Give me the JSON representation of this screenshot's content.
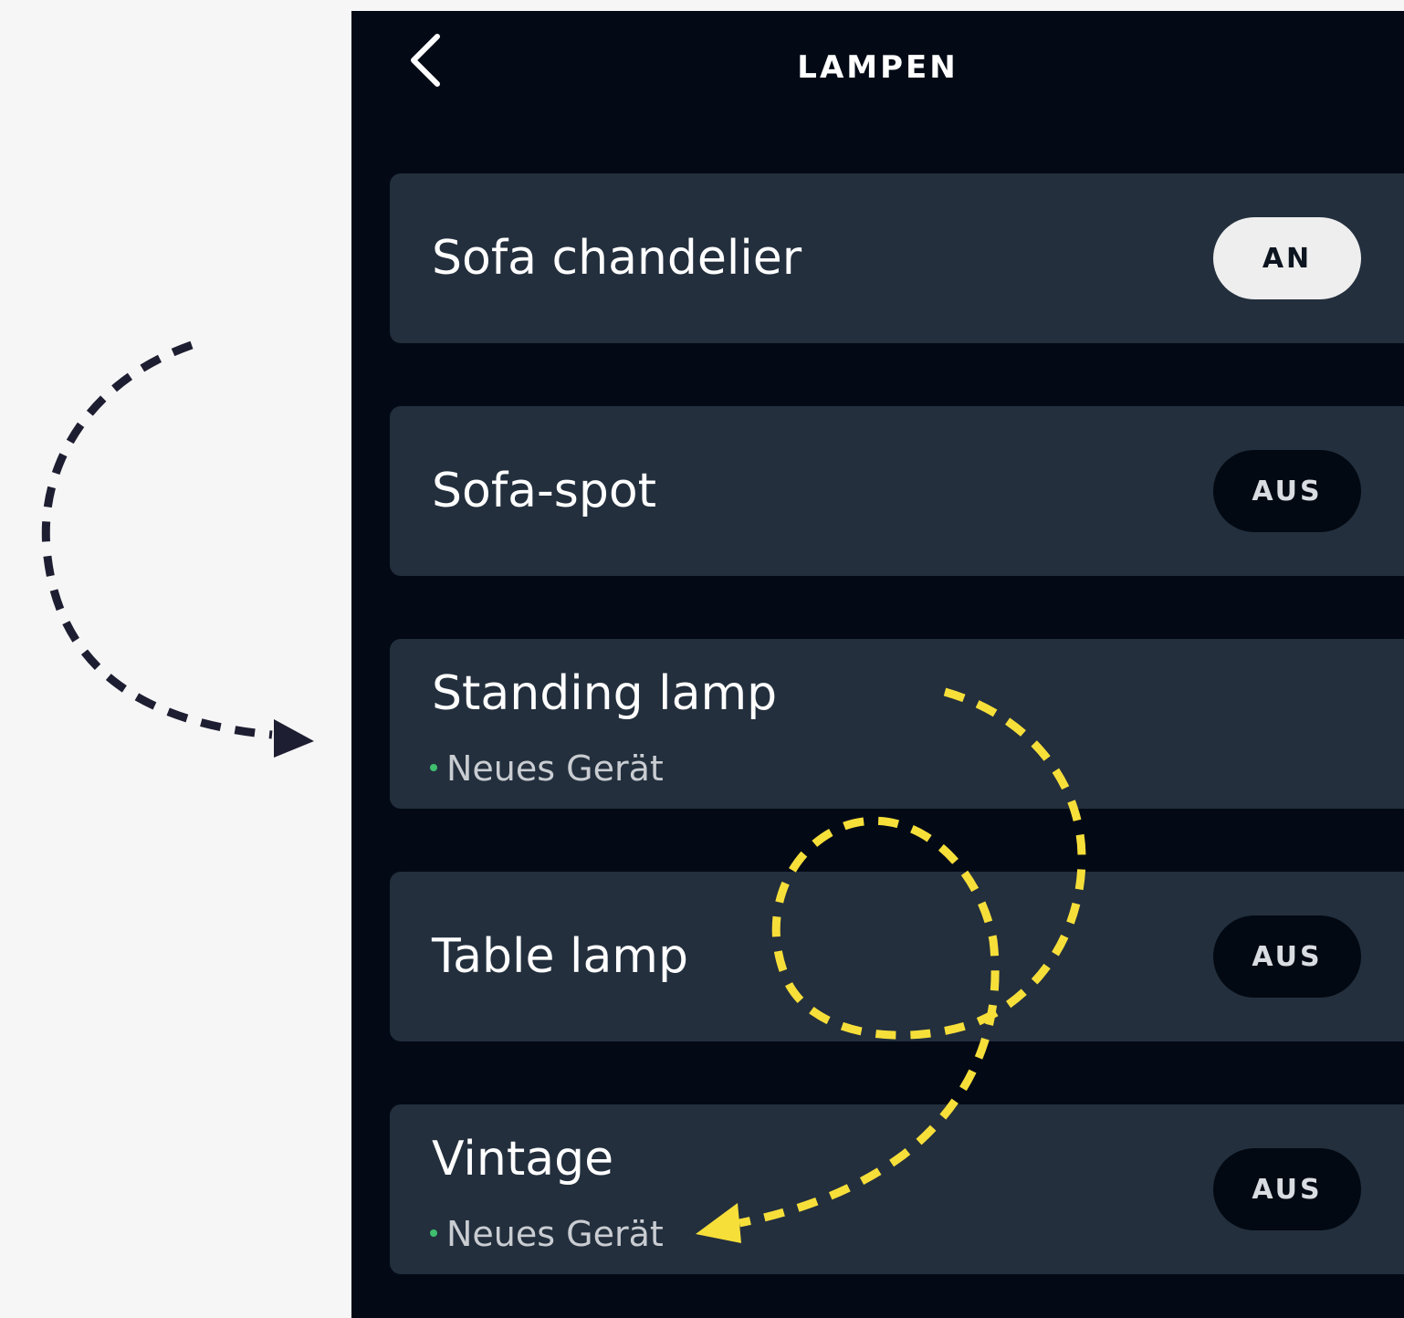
{
  "header": {
    "title": "LAMPEN",
    "back_icon": "chevron-left-icon"
  },
  "colors": {
    "page_background": "#f6f6f7",
    "app_background": "#030a16",
    "card_background": "#232f3d",
    "toggle_on_background": "#eeeeee",
    "toggle_off_background": "#020912",
    "new_device_dot": "#3fbf6f",
    "annotation_dark": "#1e1e32",
    "annotation_yellow": "#f7df3a"
  },
  "devices": [
    {
      "name": "Sofa chandelier",
      "toggle": "AN",
      "state": "on"
    },
    {
      "name": "Sofa-spot",
      "toggle": "AUS",
      "state": "off"
    },
    {
      "name": "Standing lamp",
      "status": "Neues Gerät"
    },
    {
      "name": "Table lamp",
      "toggle": "AUS",
      "state": "off"
    },
    {
      "name": "Vintage",
      "status": "Neues Gerät",
      "toggle": "AUS",
      "state": "off"
    }
  ],
  "annotations": [
    {
      "kind": "dashed-curved-arrow",
      "color": "dark"
    },
    {
      "kind": "dashed-loop-arrow",
      "color": "yellow"
    }
  ]
}
